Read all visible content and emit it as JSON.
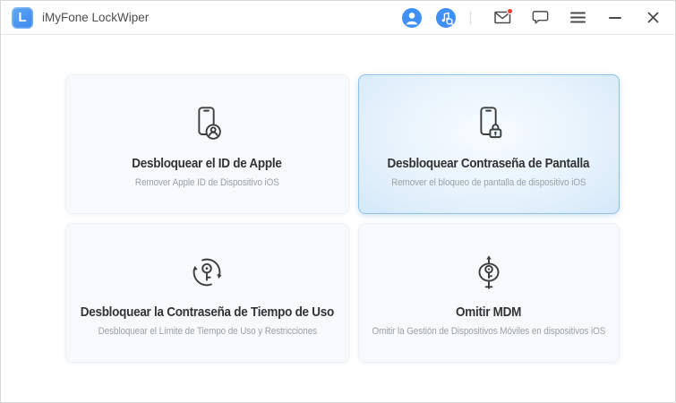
{
  "header": {
    "app_title": "iMyFone LockWiper",
    "logo_letter": "L"
  },
  "titlebar_icons": [
    "account-icon",
    "product-search-icon",
    "mail-icon",
    "chat-icon",
    "menu-icon",
    "minimize-icon",
    "close-icon"
  ],
  "mail_has_notification": true,
  "cards": [
    {
      "id": "unlock-apple-id",
      "icon": "phone-user-icon",
      "title": "Desbloquear el ID de Apple",
      "subtitle": "Remover Apple ID de Dispositivo iOS",
      "highlighted": false
    },
    {
      "id": "unlock-screen-passcode",
      "icon": "phone-lock-icon",
      "title": "Desbloquear Contraseña de Pantalla",
      "subtitle": "Remover el bloqueo de pantalla de dispositivo iOS",
      "highlighted": true
    },
    {
      "id": "unlock-screen-time-passcode",
      "icon": "key-refresh-icon",
      "title": "Desbloquear la Contraseña de Tiempo de Uso",
      "subtitle": "Desbloquear el Límite de Tiempo de Uso y Restricciones",
      "highlighted": false
    },
    {
      "id": "bypass-mdm",
      "icon": "key-bypass-icon",
      "title": "Omitir MDM",
      "subtitle": "Omitir la Gestión de Dispositivos Móviles en dispositivos iOS",
      "highlighted": false
    }
  ],
  "colors": {
    "accent_blue": "#3f8ff7",
    "highlight_card_border": "#8cc0ee",
    "highlight_card_bg": "#e7f3fc",
    "card_bg": "#f7fafc",
    "notification_red": "#f23c30",
    "title_text": "#333333",
    "subtitle_text": "#9aa0a6",
    "icon_stroke": "#3d3d3d"
  }
}
